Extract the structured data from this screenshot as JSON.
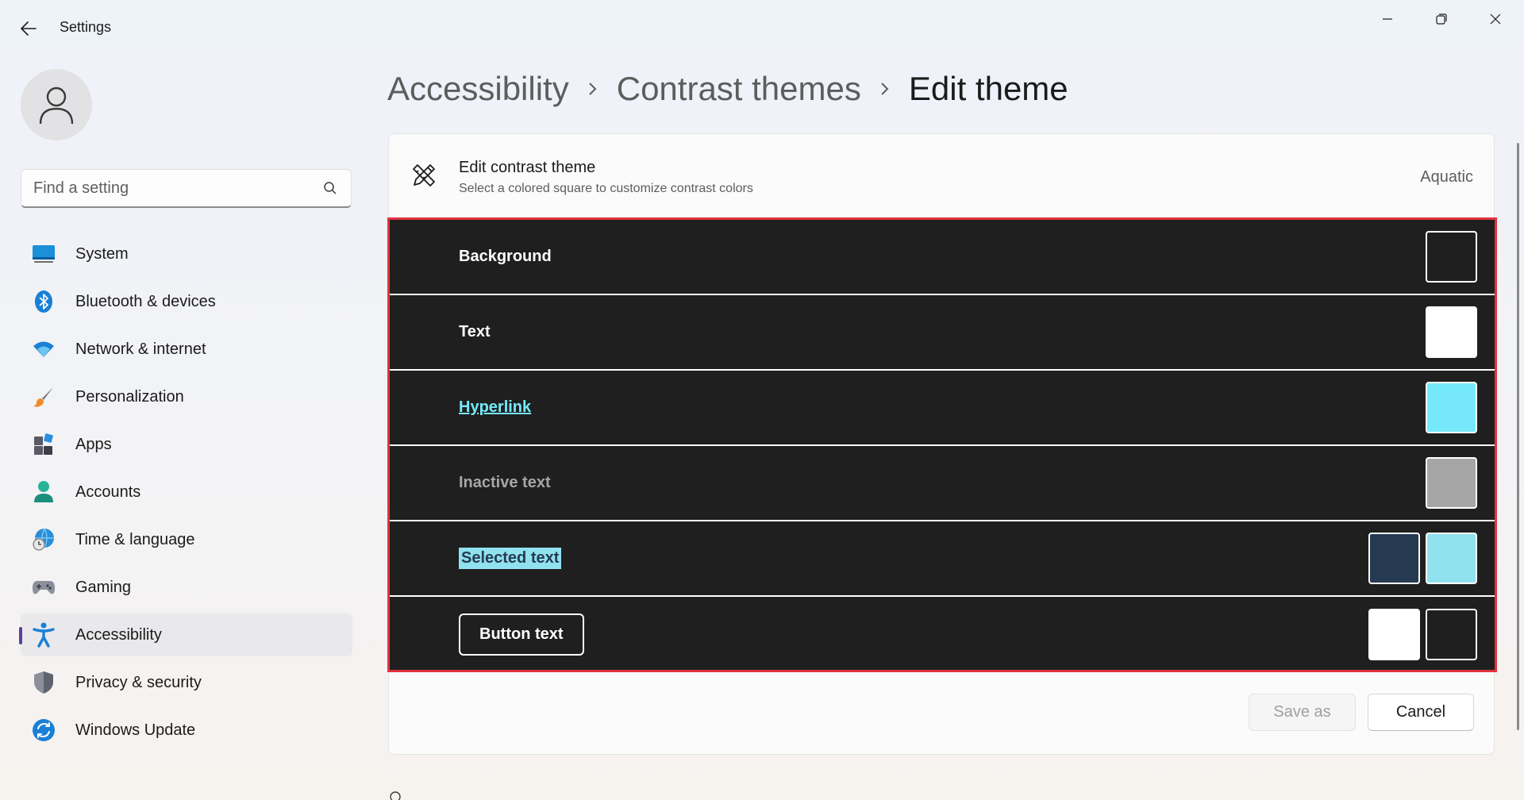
{
  "window": {
    "title": "Settings",
    "controls": [
      "minimize",
      "maximize",
      "close"
    ]
  },
  "search": {
    "placeholder": "Find a setting"
  },
  "sidebar": {
    "items": [
      {
        "label": "System",
        "icon": "system-icon"
      },
      {
        "label": "Bluetooth & devices",
        "icon": "bluetooth-icon"
      },
      {
        "label": "Network & internet",
        "icon": "wifi-icon"
      },
      {
        "label": "Personalization",
        "icon": "brush-icon"
      },
      {
        "label": "Apps",
        "icon": "apps-icon"
      },
      {
        "label": "Accounts",
        "icon": "accounts-icon"
      },
      {
        "label": "Time & language",
        "icon": "globe-clock-icon"
      },
      {
        "label": "Gaming",
        "icon": "gamepad-icon"
      },
      {
        "label": "Accessibility",
        "icon": "accessibility-icon",
        "active": true
      },
      {
        "label": "Privacy & security",
        "icon": "shield-icon"
      },
      {
        "label": "Windows Update",
        "icon": "update-icon"
      }
    ]
  },
  "breadcrumb": {
    "items": [
      "Accessibility",
      "Contrast themes",
      "Edit theme"
    ]
  },
  "card": {
    "title": "Edit contrast theme",
    "subtitle": "Select a colored square to customize contrast colors",
    "theme_name": "Aquatic"
  },
  "theme_rows": [
    {
      "label": "Background",
      "swatches": [
        "#1f1f1f"
      ]
    },
    {
      "label": "Text",
      "swatches": [
        "#ffffff"
      ]
    },
    {
      "label": "Hyperlink",
      "swatches": [
        "#75e9fb"
      ]
    },
    {
      "label": "Inactive text",
      "swatches": [
        "#a6a6a6"
      ]
    },
    {
      "label": "Selected text",
      "swatches": [
        "#263a52",
        "#8fe2ee"
      ]
    },
    {
      "label": "Button text",
      "swatches": [
        "#ffffff",
        "#1f1f1f"
      ]
    }
  ],
  "buttons": {
    "save_as": "Save as",
    "cancel": "Cancel"
  },
  "colors": {
    "highlight_border": "#e0343e",
    "theme_bg": "#1f1f1f",
    "accent": "#5b3fa0"
  }
}
